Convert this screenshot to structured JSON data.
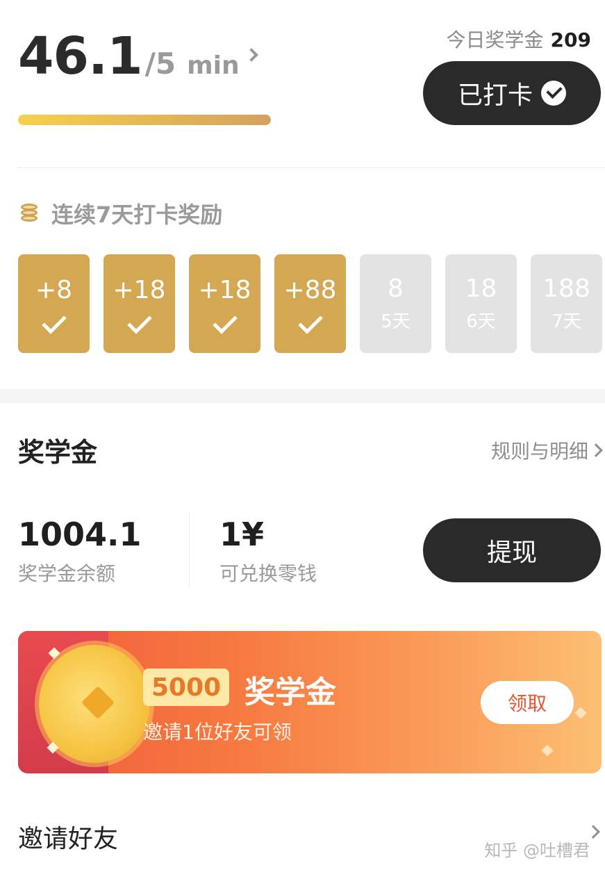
{
  "reading": {
    "minutes": "46.1",
    "goal": "/5",
    "goal_unit": "min",
    "progress_fraction": 1.0
  },
  "today": {
    "label": "今日奖学金",
    "value": "209"
  },
  "checkin": {
    "label": "已打卡"
  },
  "streak": {
    "title": "连续7天打卡奖励",
    "days": [
      {
        "amount": "+8",
        "done": true,
        "label": ""
      },
      {
        "amount": "+18",
        "done": true,
        "label": ""
      },
      {
        "amount": "+18",
        "done": true,
        "label": ""
      },
      {
        "amount": "+88",
        "done": true,
        "label": ""
      },
      {
        "amount": "8",
        "done": false,
        "label": "5天"
      },
      {
        "amount": "18",
        "done": false,
        "label": "6天"
      },
      {
        "amount": "188",
        "done": false,
        "label": "7天"
      }
    ]
  },
  "scholarship": {
    "title": "奖学金",
    "rules_link": "规则与明细",
    "balance_value": "1004.1",
    "balance_label": "奖学金余额",
    "exchange_value": "1¥",
    "exchange_label": "可兑换零钱",
    "withdraw_label": "提现"
  },
  "banner": {
    "amount": "5000",
    "title": "奖学金",
    "subtitle": "邀请1位好友可领",
    "claim_label": "领取"
  },
  "invite": {
    "label": "邀请好友"
  },
  "watermark": "知乎 @吐槽君",
  "colors": {
    "gold": "#d4a853",
    "dark_button": "#2a2a2a",
    "inactive_day": "#e3e3e3",
    "banner_start": "#f25c3e",
    "banner_end": "#fdbf74"
  }
}
